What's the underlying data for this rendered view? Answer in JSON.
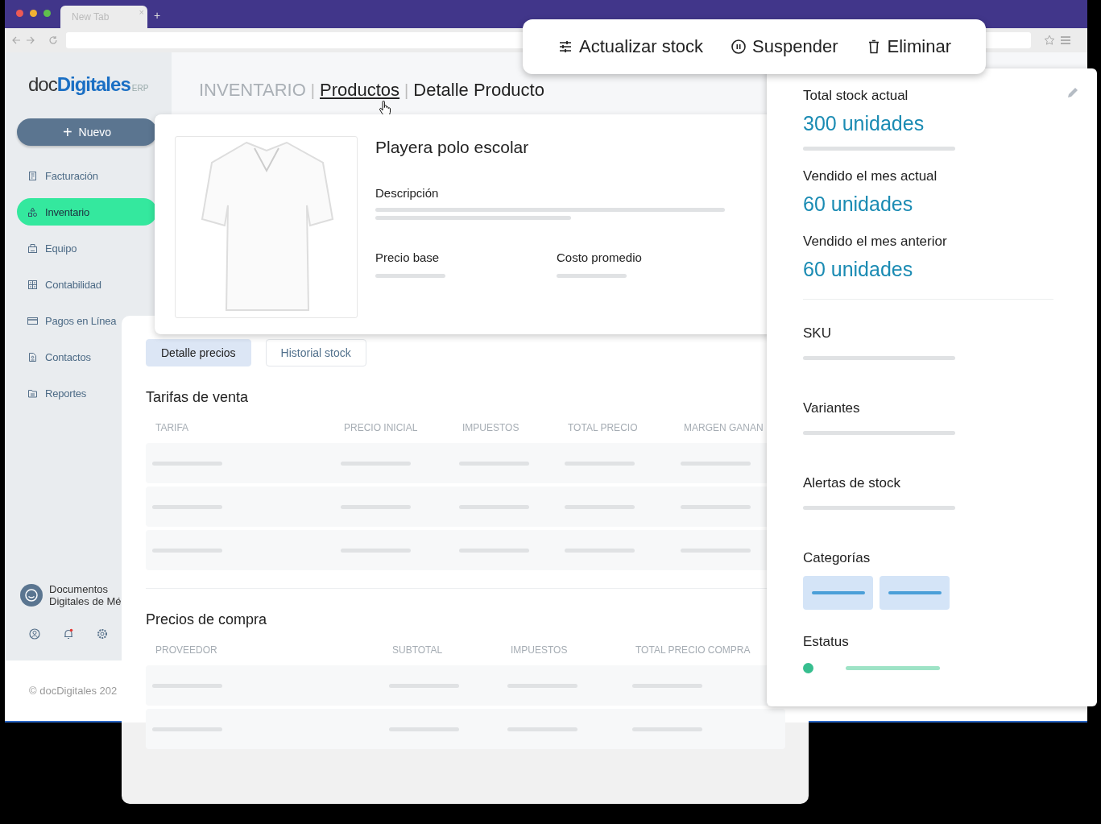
{
  "browser": {
    "tab_title": "New Tab",
    "tab_close": "×",
    "new_tab": "+"
  },
  "brand": {
    "name_light": "doc",
    "name_bold": "Digitales",
    "suffix": "ERP"
  },
  "new_button": {
    "icon": "+",
    "label": "Nuevo"
  },
  "sidebar": {
    "items": [
      {
        "label": "Facturación",
        "selected": false
      },
      {
        "label": "Inventario",
        "selected": true
      },
      {
        "label": "Equipo",
        "selected": false
      },
      {
        "label": "Contabilidad",
        "selected": false
      },
      {
        "label": "Pagos en Línea",
        "selected": false
      },
      {
        "label": "Contactos",
        "selected": false
      },
      {
        "label": "Reportes",
        "selected": false
      }
    ]
  },
  "account": {
    "lines": [
      "Documentos",
      "Digitales de Mé"
    ]
  },
  "footer": {
    "copyright": "© docDigitales 202"
  },
  "breadcrumb": {
    "separator": "|",
    "items": [
      {
        "label": "INVENTARIO",
        "kind": "section"
      },
      {
        "label": "Productos",
        "kind": "link"
      },
      {
        "label": "Detalle Producto",
        "kind": "current"
      }
    ]
  },
  "product": {
    "title": "Playera polo escolar",
    "description_label": "Descripción",
    "fields": [
      {
        "label": "Precio base"
      },
      {
        "label": "Costo promedio"
      }
    ]
  },
  "detail_tabs": [
    {
      "label": "Detalle precios",
      "selected": true
    },
    {
      "label": "Historial stock",
      "selected": false
    }
  ],
  "sales_table": {
    "title": "Tarifas de venta",
    "columns": [
      "TARIFA",
      "PRECIO INICIAL",
      "IMPUESTOS",
      "TOTAL PRECIO",
      "MARGEN GANAN"
    ]
  },
  "purchase_table": {
    "title": "Precios de compra",
    "columns": [
      "PROVEEDOR",
      "SUBTOTAL",
      "IMPUESTOS",
      "TOTAL PRECIO COMPRA"
    ]
  },
  "actions": [
    {
      "label": "Actualizar stock"
    },
    {
      "label": "Suspender"
    },
    {
      "label": "Eliminar"
    }
  ],
  "stats": [
    {
      "label": "Total stock actual",
      "value": "300 unidades"
    },
    {
      "label": "Vendido el mes actual",
      "value": "60 unidades"
    },
    {
      "label": "Vendido el mes anterior",
      "value": "60 unidades"
    }
  ],
  "attributes": [
    {
      "label": "SKU",
      "kind": "bar"
    },
    {
      "label": "Variantes",
      "kind": "bar"
    },
    {
      "label": "Alertas de stock",
      "kind": "bar"
    },
    {
      "label": "Categorías",
      "kind": "chips"
    },
    {
      "label": "Estatus",
      "kind": "status"
    }
  ]
}
